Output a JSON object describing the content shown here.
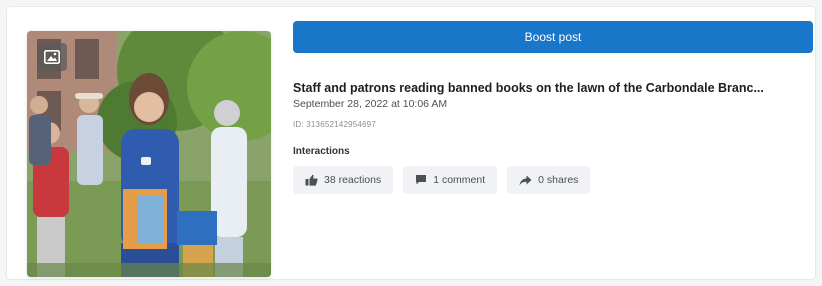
{
  "post": {
    "button_label": "Boost post",
    "title": "Staff and patrons reading banned books on the lawn of the Carbondale Branc...",
    "date": "September 28, 2022 at 10:06 AM",
    "id_label": "ID: 313652142954697",
    "interactions_label": "Interactions",
    "image_badge_icon": "image-icon"
  },
  "interactions": [
    {
      "icon": "thumbs-up-icon",
      "label": "38 reactions"
    },
    {
      "icon": "comment-icon",
      "label": "1 comment"
    },
    {
      "icon": "share-icon",
      "label": "0 shares"
    }
  ],
  "colors": {
    "accent": "#1977c9",
    "chip_bg": "#f0f2f5"
  }
}
